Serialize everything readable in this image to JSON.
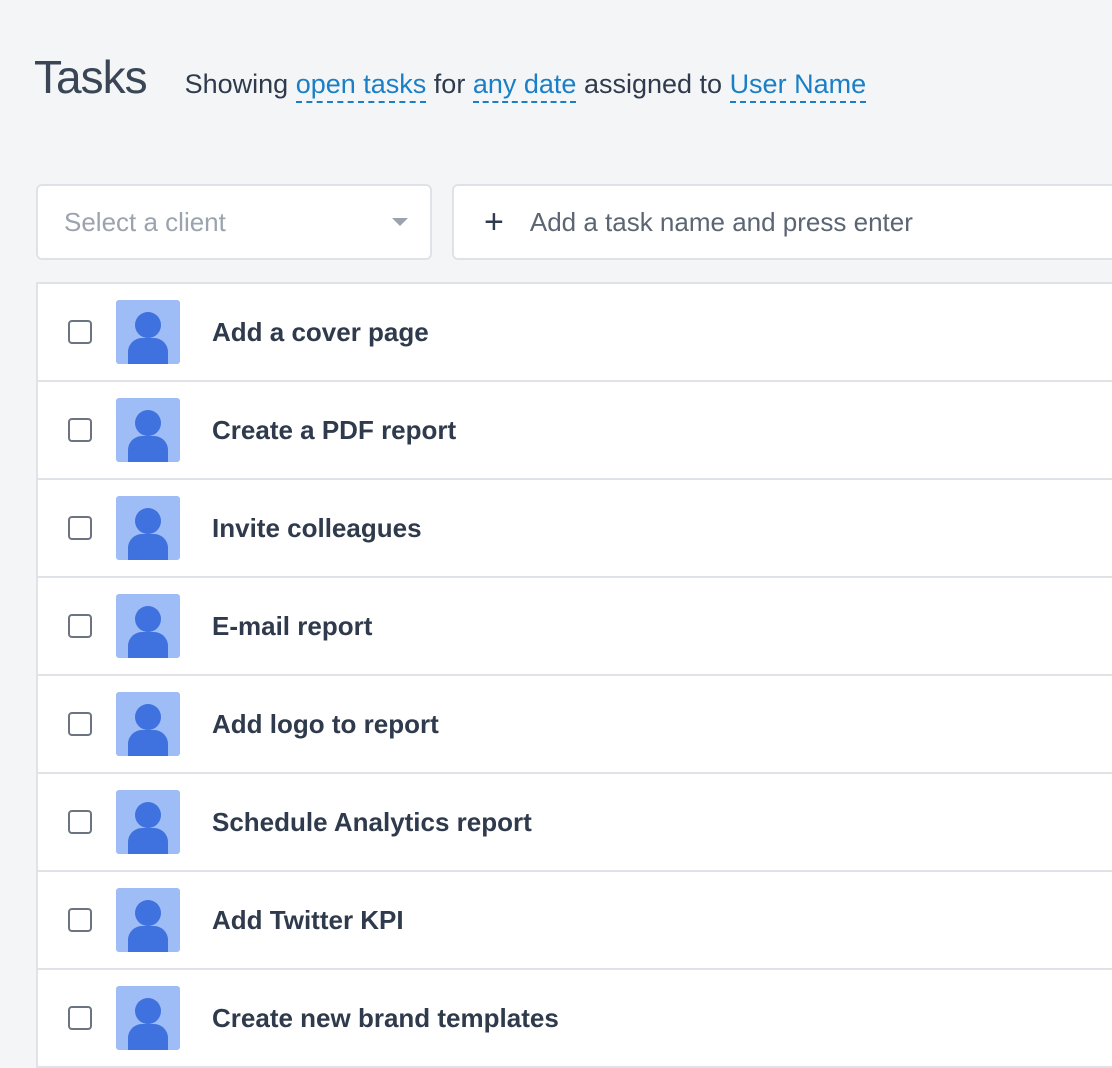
{
  "header": {
    "title": "Tasks",
    "showing": "Showing",
    "status_filter": "open tasks",
    "for": "for",
    "date_filter": "any date",
    "assigned_to": "assigned to",
    "user_filter": "User Name"
  },
  "controls": {
    "client_placeholder": "Select a client",
    "task_placeholder": "Add a task name and press enter",
    "add_symbol": "+"
  },
  "tasks": [
    {
      "name": "Add a cover page",
      "done": false
    },
    {
      "name": "Create a PDF report",
      "done": false
    },
    {
      "name": "Invite colleagues",
      "done": false
    },
    {
      "name": "E-mail report",
      "done": false
    },
    {
      "name": "Add logo to report",
      "done": false
    },
    {
      "name": "Schedule Analytics report",
      "done": false
    },
    {
      "name": "Add Twitter KPI",
      "done": false
    },
    {
      "name": "Create new brand templates",
      "done": false
    }
  ],
  "colors": {
    "accent": "#1a7fc6",
    "avatar_bg": "#9ebcf6",
    "avatar_fg": "#3f72de"
  }
}
